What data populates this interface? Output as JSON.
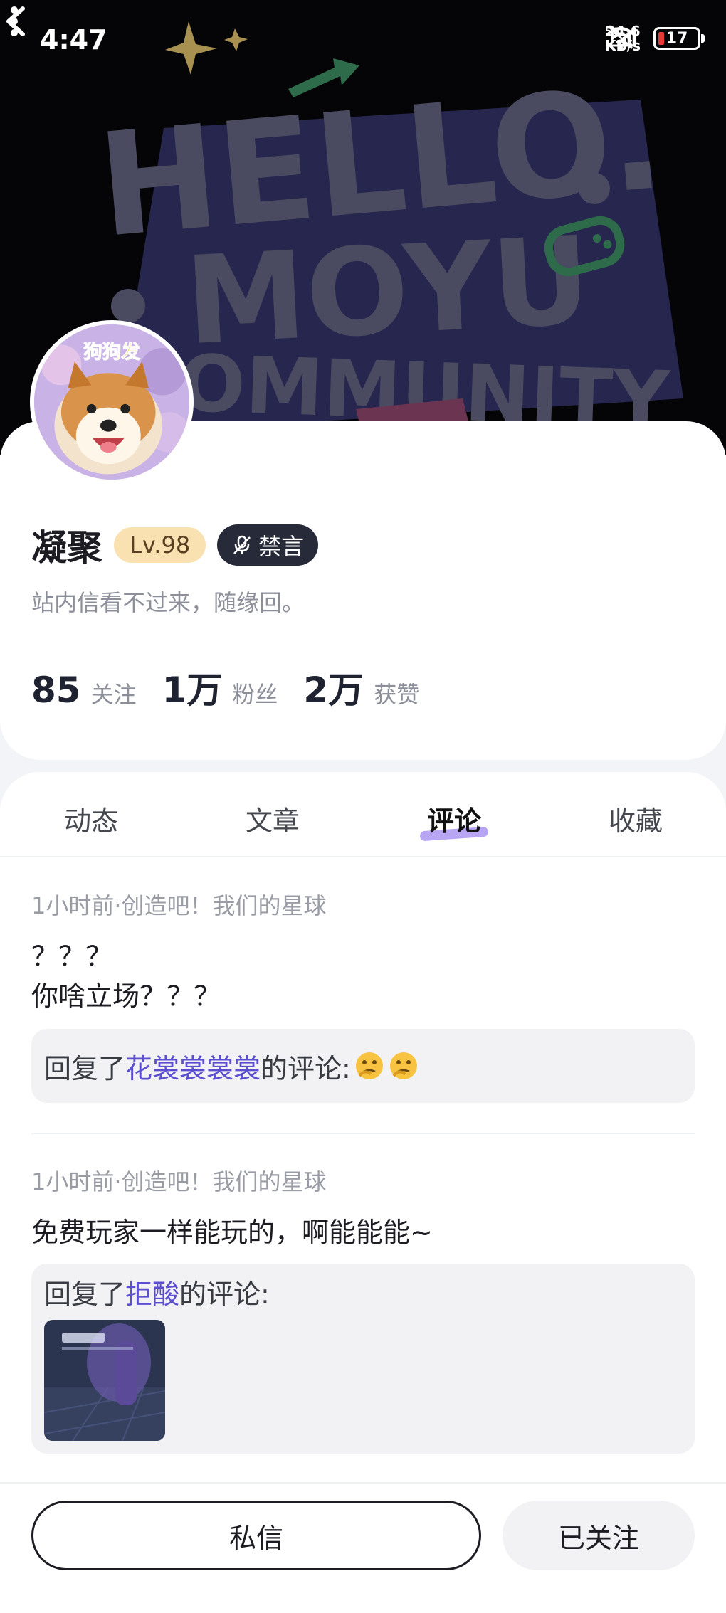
{
  "status_bar": {
    "time": "4:47",
    "net_speed_value": "24.6",
    "net_speed_unit": "KB/s",
    "signal_label": "5G",
    "battery": "17"
  },
  "banner": {
    "line1": "HELLO.",
    "line2": "MOYU",
    "line3": "COMMUNITY"
  },
  "profile": {
    "avatar_caption": "狗狗发",
    "name": "凝聚",
    "level": "Lv.98",
    "muted_label": "禁言",
    "bio": "站内信看不过来，随缘回。",
    "stats": [
      {
        "value": "85",
        "label": "关注"
      },
      {
        "value": "1万",
        "label": "粉丝"
      },
      {
        "value": "2万",
        "label": "获赞"
      }
    ]
  },
  "tabs": [
    {
      "label": "动态"
    },
    {
      "label": "文章"
    },
    {
      "label": "评论"
    },
    {
      "label": "收藏"
    }
  ],
  "active_tab": "评论",
  "comments": [
    {
      "meta": "1小时前·创造吧！我们的星球",
      "lines": [
        "？？？",
        "你啥立场？？？"
      ],
      "reply_prefix": "回复了",
      "reply_user": "花裳裳裳裳",
      "reply_suffix": "的评论:"
    },
    {
      "meta": "1小时前·创造吧！我们的星球",
      "lines": [
        "免费玩家一样能玩的，啊能能能~"
      ],
      "reply_prefix": "回复了",
      "reply_user": "拒酸",
      "reply_suffix": "的评论:"
    }
  ],
  "actions": {
    "message": "私信",
    "followed": "已关注"
  },
  "colors": {
    "accent": "#5b4fd0",
    "level_badge": "#f9e1b1",
    "muted_badge": "#262a39",
    "tab_underline": "#b9a6f3"
  }
}
